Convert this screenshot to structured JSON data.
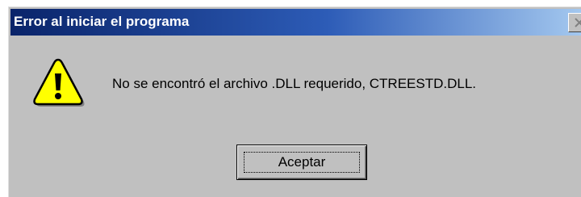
{
  "window": {
    "title": "Error al iniciar el programa",
    "close_icon": "close-icon"
  },
  "message": {
    "icon": "warning-icon",
    "text": "No se encontró el archivo .DLL requerido, CTREESTD.DLL."
  },
  "buttons": {
    "ok_label": "Aceptar"
  },
  "colors": {
    "titlebar_start": "#0a246a",
    "titlebar_end": "#a6caf0",
    "dialog_bg": "#c0c0c0",
    "warning_fill": "#ffff00"
  }
}
